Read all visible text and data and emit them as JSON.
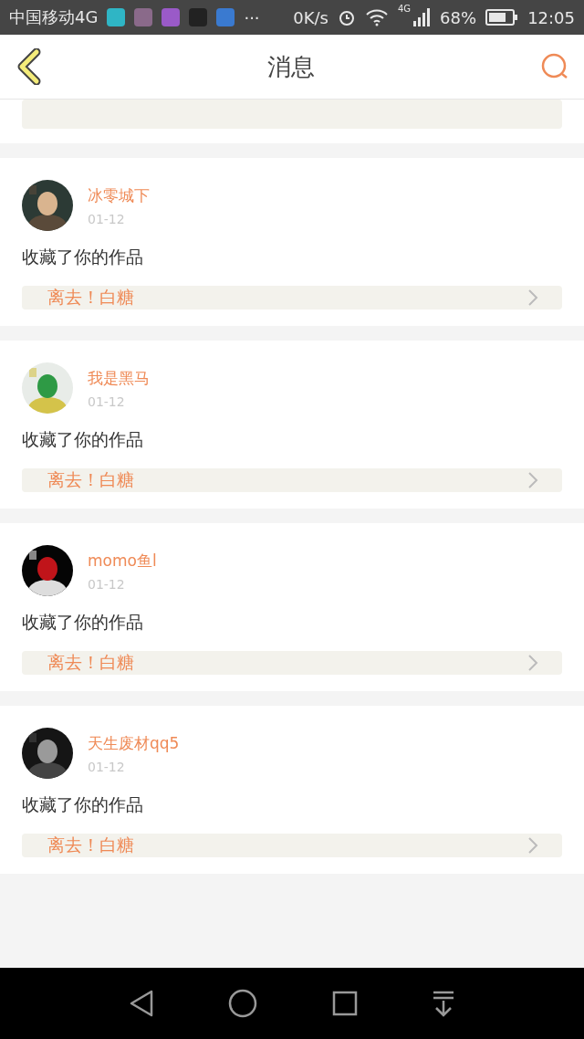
{
  "status_bar": {
    "carrier": "中国移动4G",
    "more": "···",
    "speed": "0K/s",
    "network": "4G",
    "battery": "68%",
    "time": "12:05"
  },
  "header": {
    "title": "消息"
  },
  "messages": [
    {
      "name": "冰零城下",
      "date": "01-12",
      "action": "收藏了你的作品",
      "work": "离去！白糖"
    },
    {
      "name": "我是黑马",
      "date": "01-12",
      "action": "收藏了你的作品",
      "work": "离去！白糖"
    },
    {
      "name": "momo鱼l",
      "date": "01-12",
      "action": "收藏了你的作品",
      "work": "离去！白糖"
    },
    {
      "name": "天生废材qq5",
      "date": "01-12",
      "action": "收藏了你的作品",
      "work": "离去！白糖"
    }
  ]
}
